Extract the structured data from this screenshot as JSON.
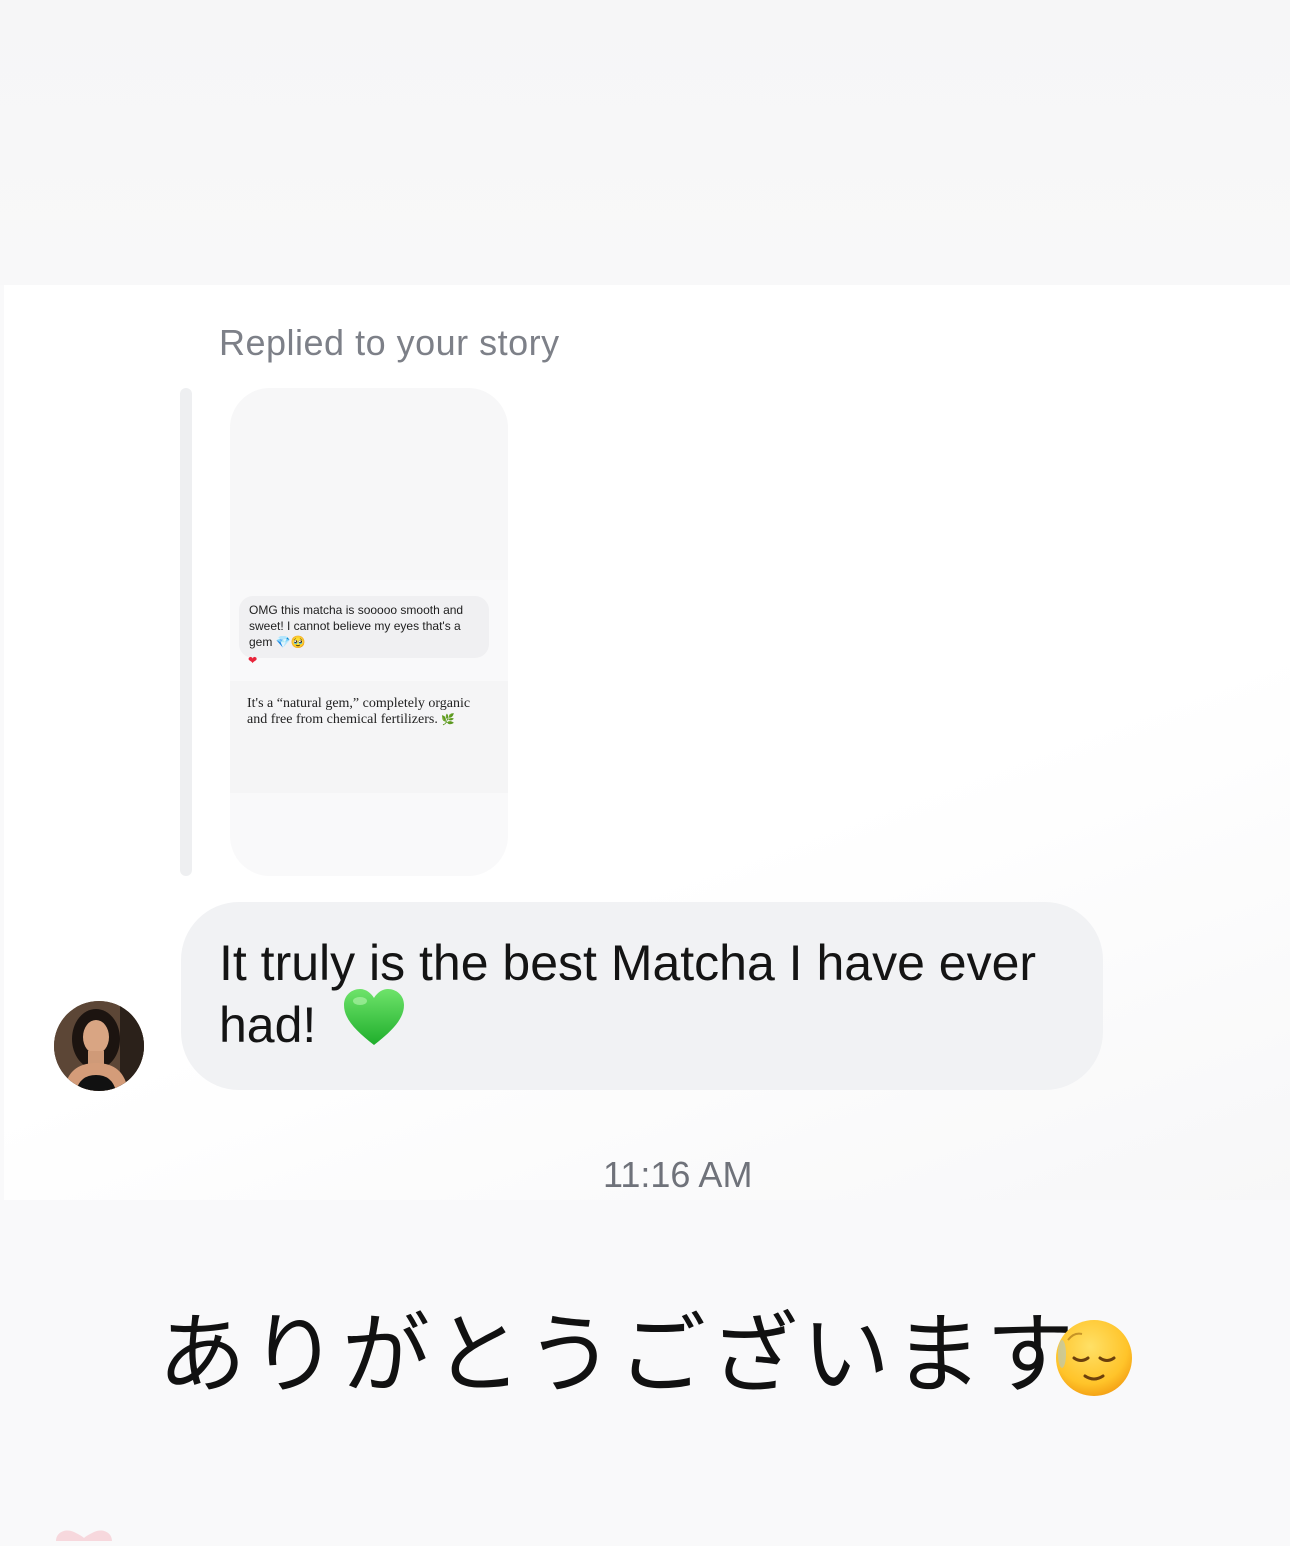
{
  "story_reply": {
    "caption": "Replied to your story",
    "story_comment": "OMG this matcha is sooooo smooth and sweet! I cannot believe my eyes that's a gem 💎🥹",
    "story_heart": "❤",
    "story_quote": "It's a “natural gem,” completely organic and free from chemical fertilizers."
  },
  "message": {
    "text": "It truly is the best Matcha I have ever had!",
    "timestamp": "11:16 AM"
  },
  "overlay": {
    "japanese_caption": "ありがとうございます"
  },
  "icons": {
    "avatar": "profile-photo",
    "heart_emoji": "green-heart-icon",
    "face_emoji": "relieved-face-icon",
    "leaf_emoji": "leaf-icon"
  },
  "colors": {
    "bubble": "#f1f2f4",
    "caption_gray": "#7d8088",
    "green_heart": "#3fd24a",
    "emoji_yellow": "#ffc92e"
  }
}
